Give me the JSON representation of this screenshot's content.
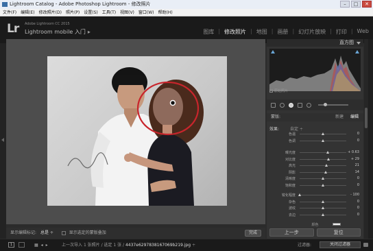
{
  "window": {
    "title": "Lightroom Catalog - Adobe Photoshop Lightroom - 修改照片",
    "controls": {
      "minimize": "–",
      "maximize": "□",
      "close": "✕"
    }
  },
  "menu": [
    "文件(F)",
    "编辑(E)",
    "修改照片(D)",
    "照片(P)",
    "设置(S)",
    "工具(T)",
    "视图(V)",
    "窗口(W)",
    "帮助(H)"
  ],
  "identity": {
    "logo": "Lr",
    "small": "Adobe Lightroom CC 2015",
    "subtitle": "Lightroom mobile 入门",
    "arrow": "▸"
  },
  "modules": [
    {
      "label": "图库",
      "active": false
    },
    {
      "label": "修改照片",
      "active": true
    },
    {
      "label": "地图",
      "active": false
    },
    {
      "label": "画册",
      "active": false
    },
    {
      "label": "幻灯片放映",
      "active": false
    },
    {
      "label": "打印",
      "active": false
    },
    {
      "label": "Web",
      "active": false
    }
  ],
  "toolbar": {
    "label": "显示编辑标记:",
    "value": "总是 ÷",
    "checkbox_label": "显示选定的蒙版叠加",
    "done": "完成"
  },
  "histogram": {
    "title": "直方图",
    "original_label": "原始照片"
  },
  "mask": {
    "label": "蒙版:",
    "new": "新建",
    "edit": "编辑"
  },
  "effect": {
    "label": "效果:",
    "preset": "自定 ÷"
  },
  "sliders_top": [
    {
      "label": "色温",
      "value": "0",
      "pos": 0.5
    },
    {
      "label": "色调",
      "value": "0",
      "pos": 0.5
    }
  ],
  "sliders_mid": [
    {
      "label": "曝光度",
      "value": "+ 0.63",
      "pos": 0.6
    },
    {
      "label": "对比度",
      "value": "+ 29",
      "pos": 0.62
    },
    {
      "label": "高光",
      "value": "21",
      "pos": 0.58
    },
    {
      "label": "阴影",
      "value": "14",
      "pos": 0.56
    },
    {
      "label": "清晰度",
      "value": "0",
      "pos": 0.5
    },
    {
      "label": "饱和度",
      "value": "0",
      "pos": 0.5
    }
  ],
  "sliders_bottom": [
    {
      "label": "锐化程度",
      "value": "- 100",
      "pos": 0.0
    },
    {
      "label": "杂色",
      "value": "0",
      "pos": 0.5
    },
    {
      "label": "波纹",
      "value": "0",
      "pos": 0.5
    },
    {
      "label": "去边",
      "value": "0",
      "pos": 0.5
    }
  ],
  "color_label": "颜色",
  "panel_buttons": {
    "prev": "上一步",
    "reset": "复位"
  },
  "filmstrip": {
    "page1": "1",
    "prev_import": "上一次导入",
    "count": "1 张照片 / 选定 1 张 /",
    "filename": "4437e6297838167069b219.jpg",
    "filename_arrow": "÷",
    "filter_label": "过滤器:",
    "filter_value": "关闭过滤器"
  },
  "colors": {
    "accent": "#c8252c",
    "panel": "#333333",
    "canvas": "#4d4d4d"
  }
}
